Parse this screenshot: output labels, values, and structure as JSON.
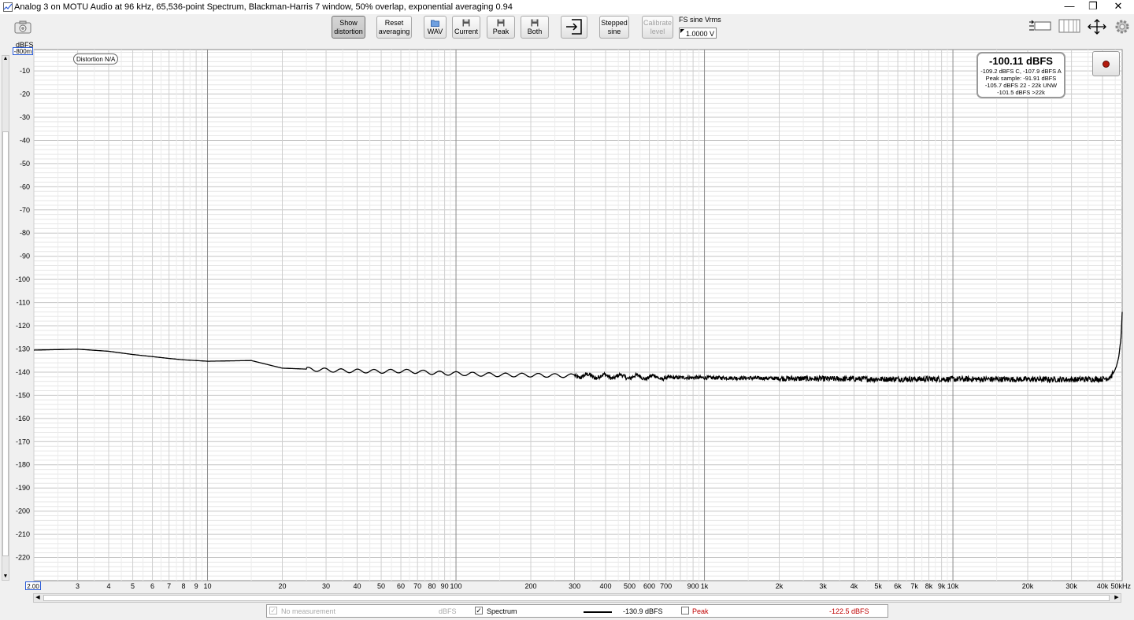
{
  "window": {
    "title": "Analog 3 on MOTU Audio at 96 kHz, 65,536-point Spectrum, Blackman-Harris 7 window, 50% overlap, exponential averaging 0.94",
    "minimize": "—",
    "restore": "❐",
    "close": "✕"
  },
  "toolbar": {
    "show_distortion": [
      "Show",
      "distortion"
    ],
    "reset_averaging": [
      "Reset",
      "averaging"
    ],
    "wav": "WAV",
    "current": "Current",
    "peak": "Peak",
    "both": "Both",
    "stepped_sine": [
      "Stepped",
      "sine"
    ],
    "calibrate_level": [
      "Calibrate",
      "level"
    ],
    "fs_label": "FS sine Vrms",
    "fs_value": "1.0000 V"
  },
  "axes": {
    "y_unit": "dBFS",
    "y_top_value": "-800m",
    "x_min_value": "2.00"
  },
  "readout": {
    "main": "-100.11 dBFS",
    "lines": [
      "-109.2 dBFS C, -107.9 dBFS A",
      "Peak sample: -91.91 dBFS",
      "-105.7 dBFS 22 - 22k UNW",
      "-101.5 dBFS >22k"
    ]
  },
  "distortion_label": "Distortion N/A",
  "legend": {
    "no_measurement": "No measurement",
    "no_measurement_unit": "dBFS",
    "spectrum": "Spectrum",
    "spectrum_value": "-130.9 dBFS",
    "peak": "Peak",
    "peak_value": "-122.5 dBFS",
    "spectrum_checked": "✓"
  },
  "colors": {
    "accent": "#2a5bd7",
    "trace": "#000000",
    "peak": "#c00000",
    "grid": "#d0d0d0",
    "record": "#b31a0d"
  },
  "chart_data": {
    "type": "line",
    "xscale": "log",
    "xlim": [
      2,
      48000
    ],
    "ylim": [
      -230,
      -0.8
    ],
    "grid": true,
    "x_ticks": [
      {
        "v": 2,
        "l": ""
      },
      {
        "v": 3,
        "l": "3"
      },
      {
        "v": 4,
        "l": "4"
      },
      {
        "v": 5,
        "l": "5"
      },
      {
        "v": 6,
        "l": "6"
      },
      {
        "v": 7,
        "l": "7"
      },
      {
        "v": 8,
        "l": "8"
      },
      {
        "v": 9,
        "l": "9"
      },
      {
        "v": 10,
        "l": "10"
      },
      {
        "v": 20,
        "l": "20"
      },
      {
        "v": 30,
        "l": "30"
      },
      {
        "v": 40,
        "l": "40"
      },
      {
        "v": 50,
        "l": "50"
      },
      {
        "v": 60,
        "l": "60"
      },
      {
        "v": 70,
        "l": "70"
      },
      {
        "v": 80,
        "l": "80"
      },
      {
        "v": 90,
        "l": "90"
      },
      {
        "v": 100,
        "l": "100"
      },
      {
        "v": 200,
        "l": "200"
      },
      {
        "v": 300,
        "l": "300"
      },
      {
        "v": 400,
        "l": "400"
      },
      {
        "v": 500,
        "l": "500"
      },
      {
        "v": 600,
        "l": "600"
      },
      {
        "v": 700,
        "l": "700"
      },
      {
        "v": 900,
        "l": "900"
      },
      {
        "v": 1000,
        "l": "1k"
      },
      {
        "v": 2000,
        "l": "2k"
      },
      {
        "v": 3000,
        "l": "3k"
      },
      {
        "v": 4000,
        "l": "4k"
      },
      {
        "v": 5000,
        "l": "5k"
      },
      {
        "v": 6000,
        "l": "6k"
      },
      {
        "v": 7000,
        "l": "7k"
      },
      {
        "v": 8000,
        "l": "8k"
      },
      {
        "v": 9000,
        "l": "9k"
      },
      {
        "v": 10000,
        "l": "10k"
      },
      {
        "v": 20000,
        "l": "20k"
      },
      {
        "v": 30000,
        "l": "30k"
      },
      {
        "v": 40000,
        "l": "40k"
      },
      {
        "v": 48000,
        "l": "50kHz"
      }
    ],
    "y_ticks": [
      -10,
      -20,
      -30,
      -40,
      -50,
      -60,
      -70,
      -80,
      -90,
      -100,
      -110,
      -120,
      -130,
      -140,
      -150,
      -160,
      -170,
      -180,
      -190,
      -200,
      -210,
      -220
    ],
    "series": [
      {
        "x": [
          2,
          3,
          4,
          5,
          6,
          7,
          8,
          9,
          10,
          15,
          20,
          25,
          30,
          35,
          40,
          45,
          50,
          60,
          70,
          80,
          90,
          100,
          120,
          150,
          200,
          300,
          400,
          500,
          700,
          1000,
          2000,
          3000,
          5000,
          10000,
          20000,
          30000,
          40000,
          42000,
          43500,
          44500,
          45500,
          46500,
          47500,
          48000
        ],
        "y": [
          -130.5,
          -130.1,
          -131,
          -132.4,
          -133.3,
          -134.1,
          -134.7,
          -135,
          -135.3,
          -135,
          -138.3,
          -138.7,
          -139.1,
          -139.4,
          -139.5,
          -139.6,
          -139.7,
          -139.5,
          -139.8,
          -140.2,
          -140.5,
          -140.6,
          -140.9,
          -141.2,
          -141.3,
          -141.6,
          -141.8,
          -142,
          -142.3,
          -142.4,
          -142.7,
          -142.9,
          -143,
          -143,
          -143.1,
          -143.2,
          -143,
          -142.6,
          -141.6,
          -140,
          -137.5,
          -133.5,
          -125,
          -114
        ]
      }
    ]
  }
}
